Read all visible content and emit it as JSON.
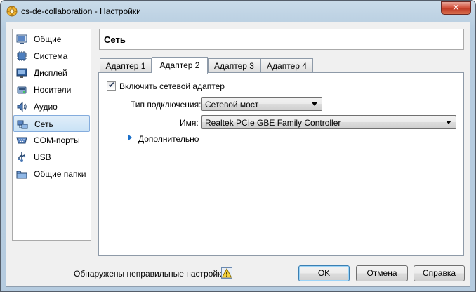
{
  "window": {
    "title": "cs-de-collaboration - Настройки"
  },
  "sidebar": {
    "items": [
      {
        "label": "Общие",
        "icon": "general-settings-icon",
        "selected": false
      },
      {
        "label": "Система",
        "icon": "system-chip-icon",
        "selected": false
      },
      {
        "label": "Дисплей",
        "icon": "display-monitor-icon",
        "selected": false
      },
      {
        "label": "Носители",
        "icon": "storage-disk-icon",
        "selected": false
      },
      {
        "label": "Аудио",
        "icon": "audio-speaker-icon",
        "selected": false
      },
      {
        "label": "Сеть",
        "icon": "network-icon",
        "selected": true
      },
      {
        "label": "COM-порты",
        "icon": "serial-port-icon",
        "selected": false
      },
      {
        "label": "USB",
        "icon": "usb-icon",
        "selected": false
      },
      {
        "label": "Общие папки",
        "icon": "shared-folder-icon",
        "selected": false
      }
    ]
  },
  "header": {
    "title": "Сеть"
  },
  "tabs": [
    {
      "label": "Адаптер 1",
      "active": false
    },
    {
      "label": "Адаптер 2",
      "active": true
    },
    {
      "label": "Адаптер 3",
      "active": false
    },
    {
      "label": "Адаптер 4",
      "active": false
    }
  ],
  "adapter": {
    "enable_label": "Включить сетевой адаптер",
    "enabled": true,
    "attach_label": "Тип подключения:",
    "attach_value": "Сетевой мост",
    "name_label": "Имя:",
    "name_value": "Realtek PCIe GBE Family Controller",
    "advanced_label": "Дополнительно"
  },
  "footer": {
    "status": "Обнаружены неправильные настройки",
    "ok": "OK",
    "cancel": "Отмена",
    "help": "Справка"
  },
  "colors": {
    "accent": "#1a6fc9",
    "selection": "#c9e2f6",
    "titlebar": "#b9cfe3",
    "close": "#c7432d"
  }
}
